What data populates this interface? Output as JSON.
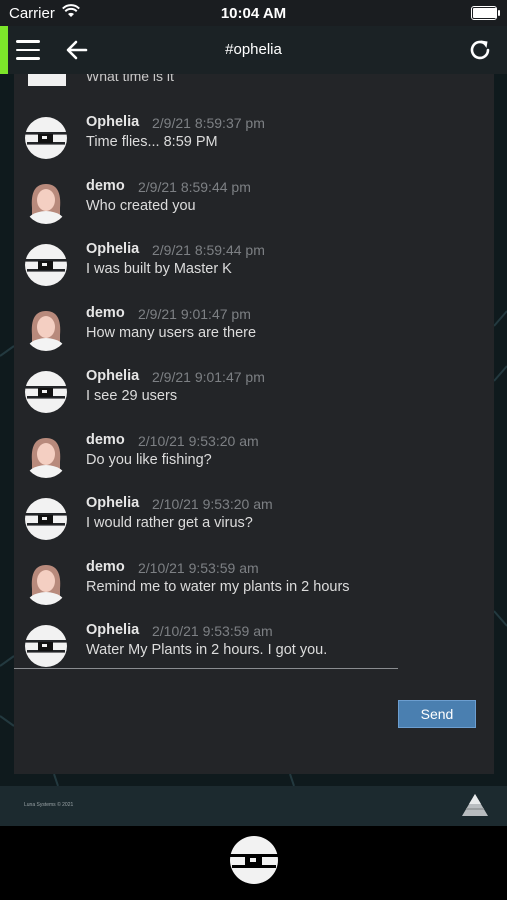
{
  "status_bar": {
    "carrier": "Carrier",
    "time": "10:04 AM",
    "battery_level": 1.0
  },
  "nav": {
    "title": "#ophelia"
  },
  "chat": {
    "partial_message": "What time is it",
    "messages": [
      {
        "sender": "Ophelia",
        "avatar": "ophelia-logo-icon",
        "timestamp": "2/9/21 8:59:37 pm",
        "text": "Time flies... 8:59 PM"
      },
      {
        "sender": "demo",
        "avatar": "user-avatar-icon",
        "timestamp": "2/9/21 8:59:44 pm",
        "text": "Who created you"
      },
      {
        "sender": "Ophelia",
        "avatar": "ophelia-logo-icon",
        "timestamp": "2/9/21 8:59:44 pm",
        "text": "I was built by Master K"
      },
      {
        "sender": "demo",
        "avatar": "user-avatar-icon",
        "timestamp": "2/9/21 9:01:47 pm",
        "text": "How many users are there"
      },
      {
        "sender": "Ophelia",
        "avatar": "ophelia-logo-icon",
        "timestamp": "2/9/21 9:01:47 pm",
        "text": "I see 29 users"
      },
      {
        "sender": "demo",
        "avatar": "user-avatar-icon",
        "timestamp": "2/10/21 9:53:20 am",
        "text": "Do you like fishing?"
      },
      {
        "sender": "Ophelia",
        "avatar": "ophelia-logo-icon",
        "timestamp": "2/10/21 9:53:20 am",
        "text": "I would rather get a virus?"
      },
      {
        "sender": "demo",
        "avatar": "user-avatar-icon",
        "timestamp": "2/10/21 9:53:59 am",
        "text": "Remind me to water my plants in 2 hours"
      },
      {
        "sender": "Ophelia",
        "avatar": "ophelia-logo-icon",
        "timestamp": "2/10/21 9:53:59 am",
        "text": "Water My Plants in 2 hours. I got you."
      }
    ],
    "input": {
      "value": "",
      "placeholder": ""
    },
    "send_label": "Send"
  },
  "footer": {
    "copyright": "Luna Systems © 2021"
  },
  "colors": {
    "accent": "#7ce52a",
    "send_button": "#4a7fb0",
    "panel": "#232528"
  }
}
